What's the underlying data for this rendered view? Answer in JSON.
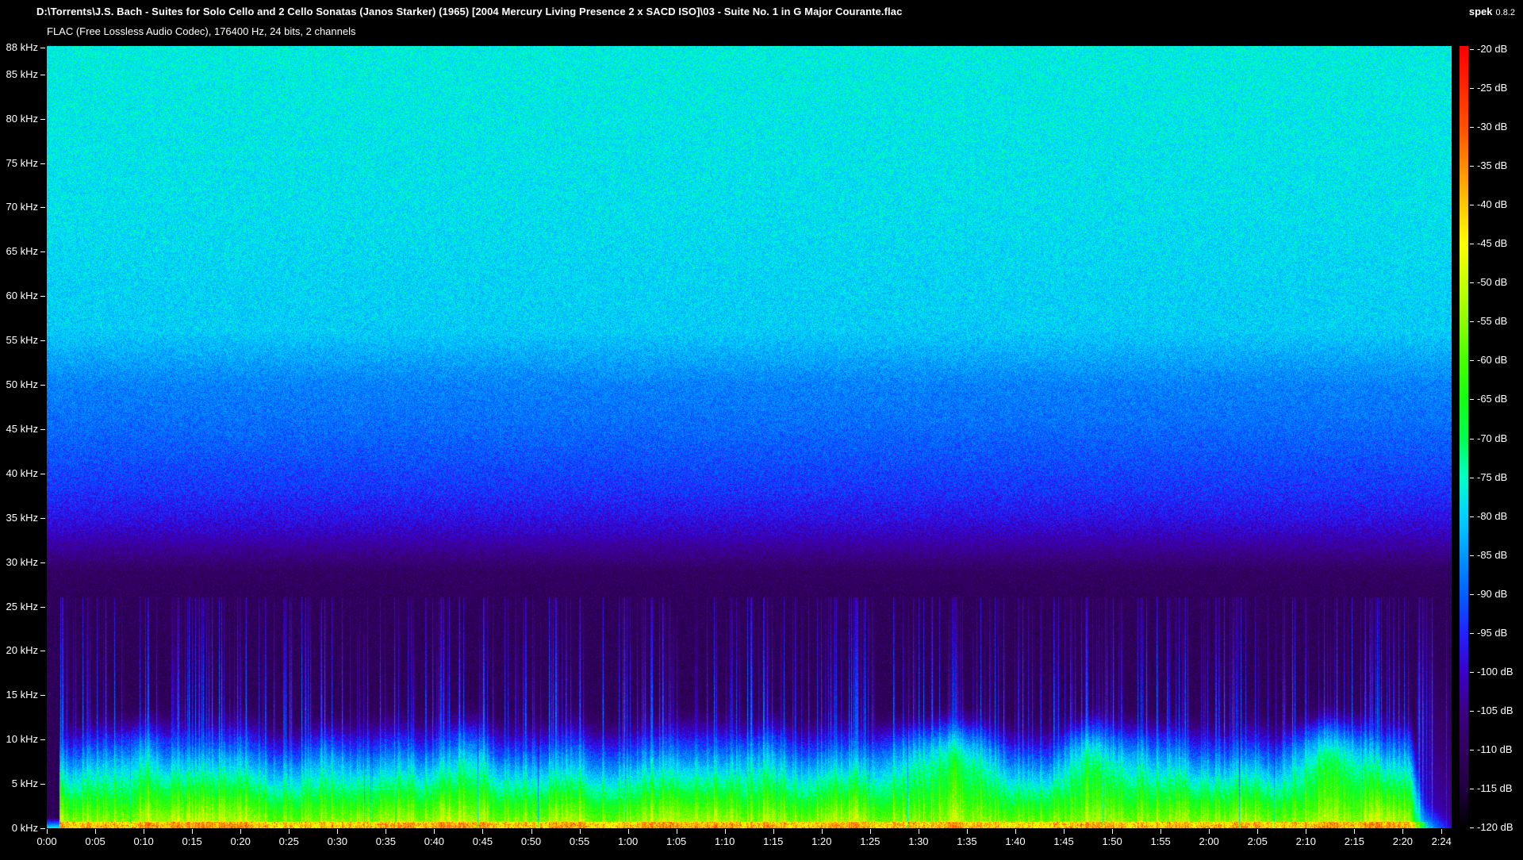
{
  "header": {
    "file_path": "D:\\Torrents\\J.S. Bach - Suites for Solo Cello and 2 Cello Sonatas (Janos Starker) (1965) [2004 Mercury Living Presence 2 x SACD ISO]\\03 - Suite No. 1 in G Major Courante.flac",
    "app_name": "spek",
    "app_version": "0.8.2",
    "format_info": "FLAC (Free Lossless Audio Codec), 176400 Hz, 24 bits, 2 channels"
  },
  "chart_data": {
    "type": "heatmap",
    "subtype": "audio-spectrogram",
    "x_axis": {
      "unit": "time",
      "duration_seconds": 145,
      "tick_labels": [
        "0:00",
        "0:05",
        "0:10",
        "0:15",
        "0:20",
        "0:25",
        "0:30",
        "0:35",
        "0:40",
        "0:45",
        "0:50",
        "0:55",
        "1:00",
        "1:05",
        "1:10",
        "1:15",
        "1:20",
        "1:25",
        "1:30",
        "1:35",
        "1:40",
        "1:45",
        "1:50",
        "1:55",
        "2:00",
        "2:05",
        "2:10",
        "2:15",
        "2:20",
        "2:24"
      ],
      "tick_seconds": [
        0,
        5,
        10,
        15,
        20,
        25,
        30,
        35,
        40,
        45,
        50,
        55,
        60,
        65,
        70,
        75,
        80,
        85,
        90,
        95,
        100,
        105,
        110,
        115,
        120,
        125,
        130,
        135,
        140,
        144
      ]
    },
    "y_axis": {
      "unit": "frequency",
      "max_khz": 88.2,
      "tick_labels": [
        "88 kHz",
        "85 kHz",
        "80 kHz",
        "75 kHz",
        "70 kHz",
        "65 kHz",
        "60 kHz",
        "55 kHz",
        "50 kHz",
        "45 kHz",
        "40 kHz",
        "35 kHz",
        "30 kHz",
        "25 kHz",
        "20 kHz",
        "15 kHz",
        "10 kHz",
        "5 kHz",
        "0 kHz"
      ],
      "tick_khz": [
        88,
        85,
        80,
        75,
        70,
        65,
        60,
        55,
        50,
        45,
        40,
        35,
        30,
        25,
        20,
        15,
        10,
        5,
        0
      ]
    },
    "legend": {
      "unit": "dB",
      "range_db": [
        -120,
        -20
      ],
      "tick_labels": [
        "-20 dB",
        "-25 dB",
        "-30 dB",
        "-35 dB",
        "-40 dB",
        "-45 dB",
        "-50 dB",
        "-55 dB",
        "-60 dB",
        "-65 dB",
        "-70 dB",
        "-75 dB",
        "-80 dB",
        "-85 dB",
        "-90 dB",
        "-95 dB",
        "-100 dB",
        "-105 dB",
        "-110 dB",
        "-115 dB",
        "-120 dB"
      ],
      "tick_db": [
        -20,
        -25,
        -30,
        -35,
        -40,
        -45,
        -50,
        -55,
        -60,
        -65,
        -70,
        -75,
        -80,
        -85,
        -90,
        -95,
        -100,
        -105,
        -110,
        -115,
        -120
      ]
    },
    "palette": [
      {
        "db": -120,
        "color": "#000000"
      },
      {
        "db": -115,
        "color": "#200040"
      },
      {
        "db": -110,
        "color": "#32005e"
      },
      {
        "db": -105,
        "color": "#3c0086"
      },
      {
        "db": -100,
        "color": "#3a00c8"
      },
      {
        "db": -95,
        "color": "#2222ff"
      },
      {
        "db": -90,
        "color": "#0060ff"
      },
      {
        "db": -85,
        "color": "#0098ff"
      },
      {
        "db": -80,
        "color": "#00d2ff"
      },
      {
        "db": -75,
        "color": "#00ffc8"
      },
      {
        "db": -70,
        "color": "#00ff50"
      },
      {
        "db": -65,
        "color": "#14ff14"
      },
      {
        "db": -60,
        "color": "#46ff00"
      },
      {
        "db": -55,
        "color": "#8cff00"
      },
      {
        "db": -50,
        "color": "#c8ff00"
      },
      {
        "db": -45,
        "color": "#ffff00"
      },
      {
        "db": -40,
        "color": "#ffc800"
      },
      {
        "db": -35,
        "color": "#ff8c00"
      },
      {
        "db": -30,
        "color": "#ff5000"
      },
      {
        "db": -25,
        "color": "#ff2800"
      },
      {
        "db": -20,
        "color": "#ff0000"
      }
    ],
    "noise_floor_profile_db_by_khz": [
      [
        0,
        -111
      ],
      [
        22,
        -111
      ],
      [
        26,
        -110.5
      ],
      [
        29,
        -109.5
      ],
      [
        31,
        -105
      ],
      [
        33,
        -101
      ],
      [
        35,
        -97.5
      ],
      [
        38,
        -94
      ],
      [
        42,
        -91
      ],
      [
        46,
        -88.5
      ],
      [
        50,
        -87
      ],
      [
        56,
        -80.5
      ],
      [
        70,
        -78.5
      ],
      [
        88.2,
        -77
      ]
    ],
    "music": {
      "start_s": 1.3,
      "fade_start_s": 140.8,
      "reverb_start_s": 141.4,
      "body_db_at_0khz": -56,
      "body_rolloff_db_per_khz": 4.6,
      "attack_streak_max_khz": 26,
      "high_energy_patches_s": [
        [
          86,
          100
        ],
        [
          104,
          111
        ],
        [
          127,
          138
        ]
      ]
    }
  }
}
